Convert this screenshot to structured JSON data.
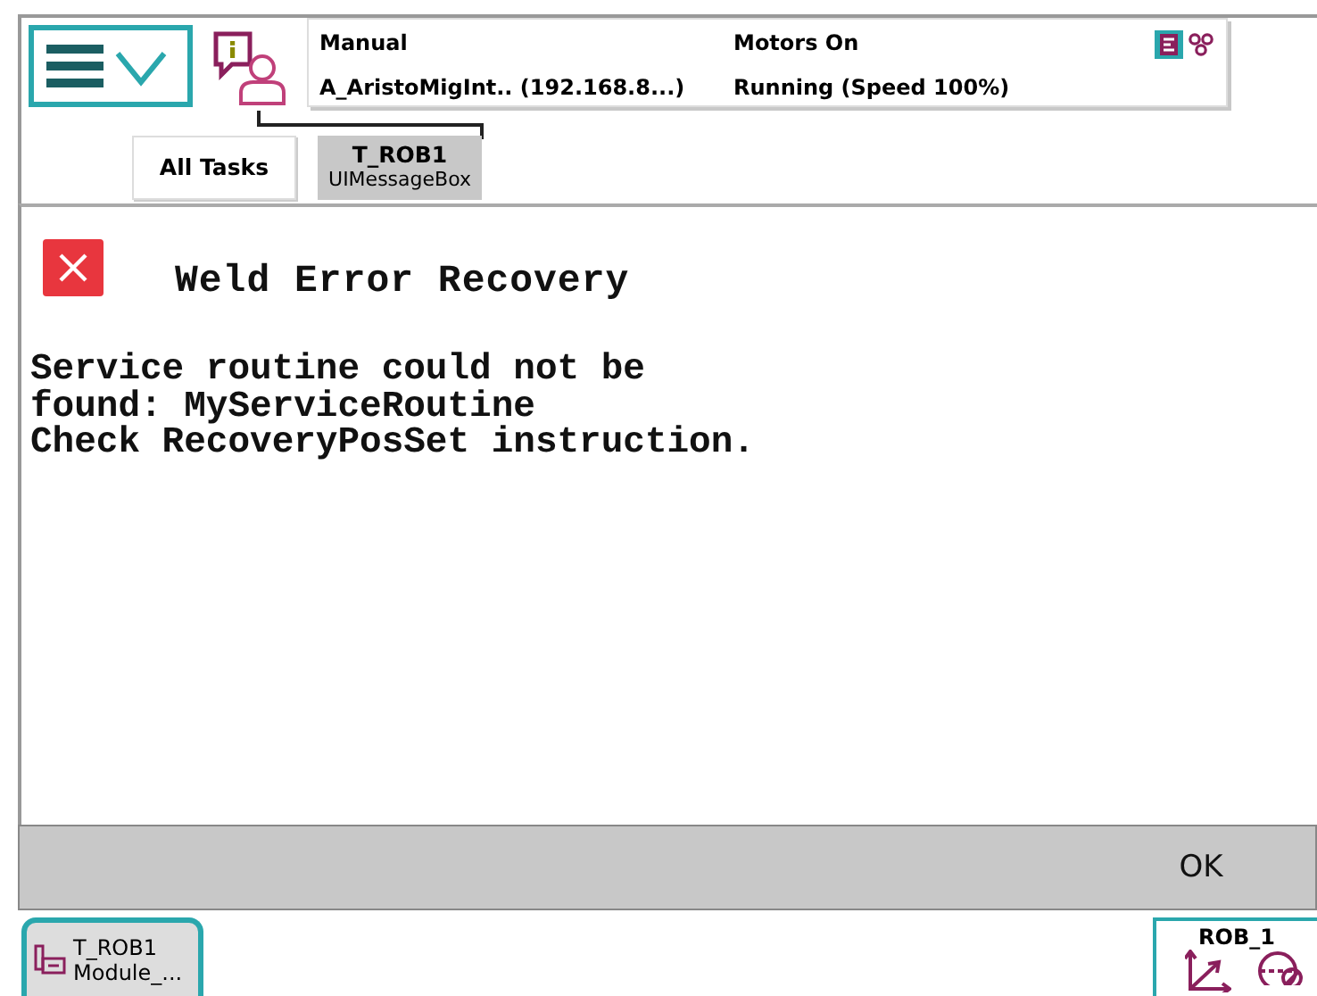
{
  "status": {
    "mode": "Manual",
    "controller": "A_AristoMigInt.. (192.168.8...)",
    "motors": "Motors On",
    "run_state": "Running (Speed 100%)"
  },
  "tabs": [
    {
      "title": "All Tasks",
      "selected": false
    },
    {
      "title": "T_ROB1",
      "subtitle": "UIMessageBox",
      "selected": true
    }
  ],
  "message": {
    "title": "Weld Error Recovery",
    "lines": [
      "Service routine could not be",
      "found: MyServiceRoutine",
      "Check RecoveryPosSet instruction."
    ]
  },
  "buttons": [
    "OK"
  ],
  "taskbar": {
    "task": {
      "line1": "T_ROB1",
      "line2": "Module_..."
    },
    "mechanical_unit": "ROB_1"
  }
}
